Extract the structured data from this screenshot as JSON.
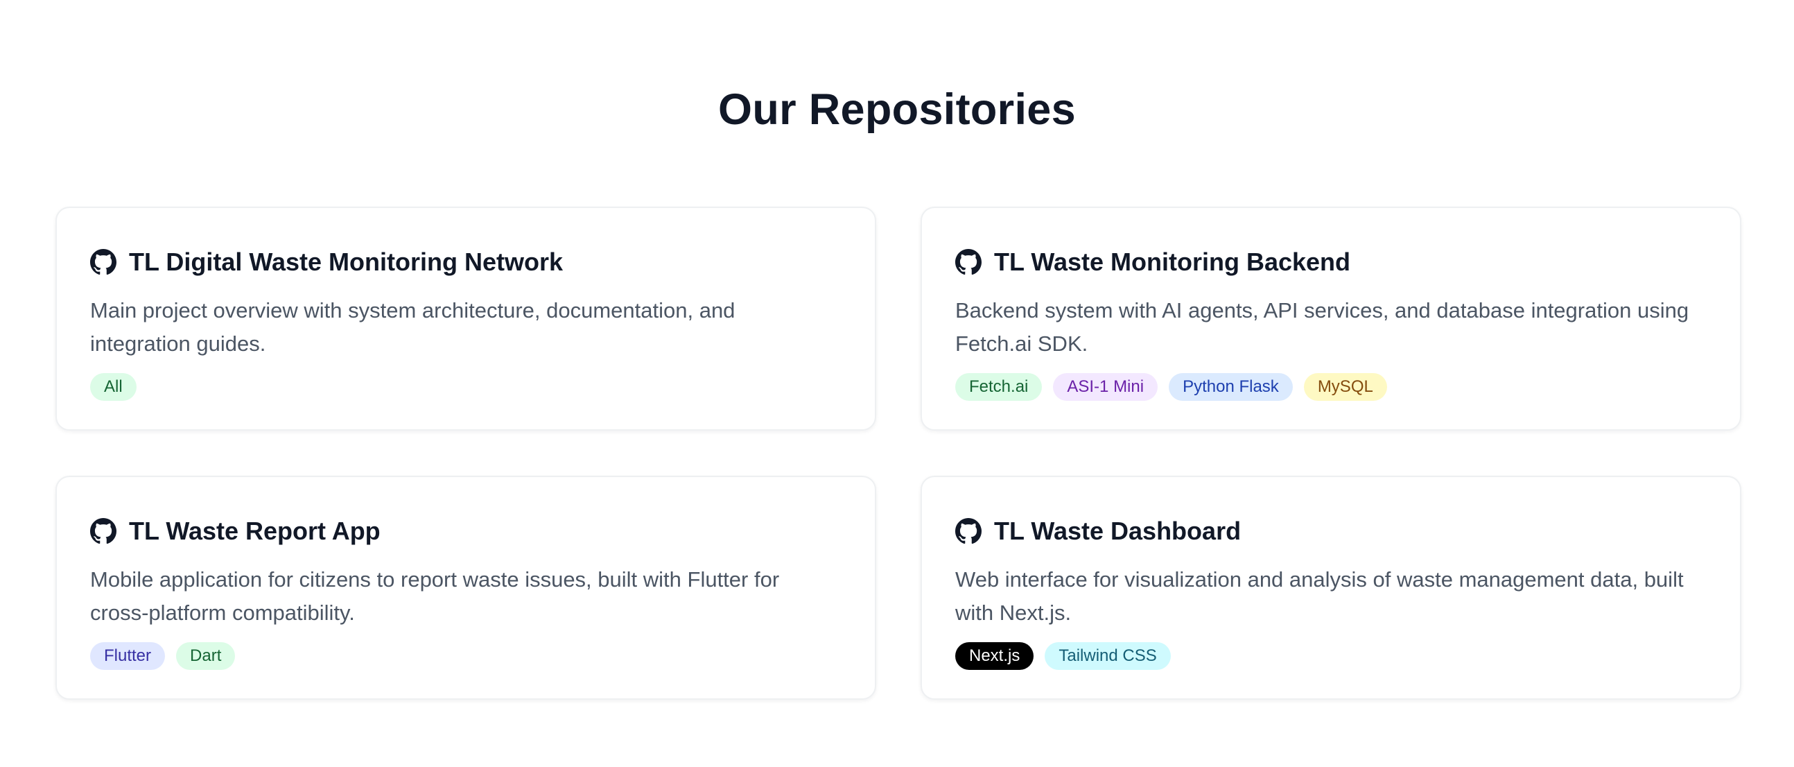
{
  "section": {
    "title": "Our Repositories"
  },
  "repos": [
    {
      "name": "TL Digital Waste Monitoring Network",
      "description": "Main project overview with system architecture, documentation, and integration guides.",
      "icon": "github-icon",
      "tags": [
        {
          "label": "All",
          "bg": "#dcfce7",
          "color": "#166534"
        }
      ]
    },
    {
      "name": "TL Waste Monitoring Backend",
      "description": "Backend system with AI agents, API services, and database integration using Fetch.ai SDK.",
      "icon": "github-icon",
      "tags": [
        {
          "label": "Fetch.ai",
          "bg": "#dcfce7",
          "color": "#166534"
        },
        {
          "label": "ASI-1 Mini",
          "bg": "#f3e8ff",
          "color": "#6b21a8"
        },
        {
          "label": "Python Flask",
          "bg": "#dbeafe",
          "color": "#1e40af"
        },
        {
          "label": "MySQL",
          "bg": "#fef9c3",
          "color": "#854d0e"
        }
      ]
    },
    {
      "name": "TL Waste Report App",
      "description": "Mobile application for citizens to report waste issues, built with Flutter for cross-platform compatibility.",
      "icon": "github-icon",
      "tags": [
        {
          "label": "Flutter",
          "bg": "#e0e7ff",
          "color": "#3730a3"
        },
        {
          "label": "Dart",
          "bg": "#dcfce7",
          "color": "#166534"
        }
      ]
    },
    {
      "name": "TL Waste Dashboard",
      "description": "Web interface for visualization and analysis of waste management data, built with Next.js.",
      "icon": "github-icon",
      "tags": [
        {
          "label": "Next.js",
          "bg": "#000000",
          "color": "#ffffff"
        },
        {
          "label": "Tailwind CSS",
          "bg": "#cffafe",
          "color": "#155e75"
        }
      ]
    }
  ]
}
